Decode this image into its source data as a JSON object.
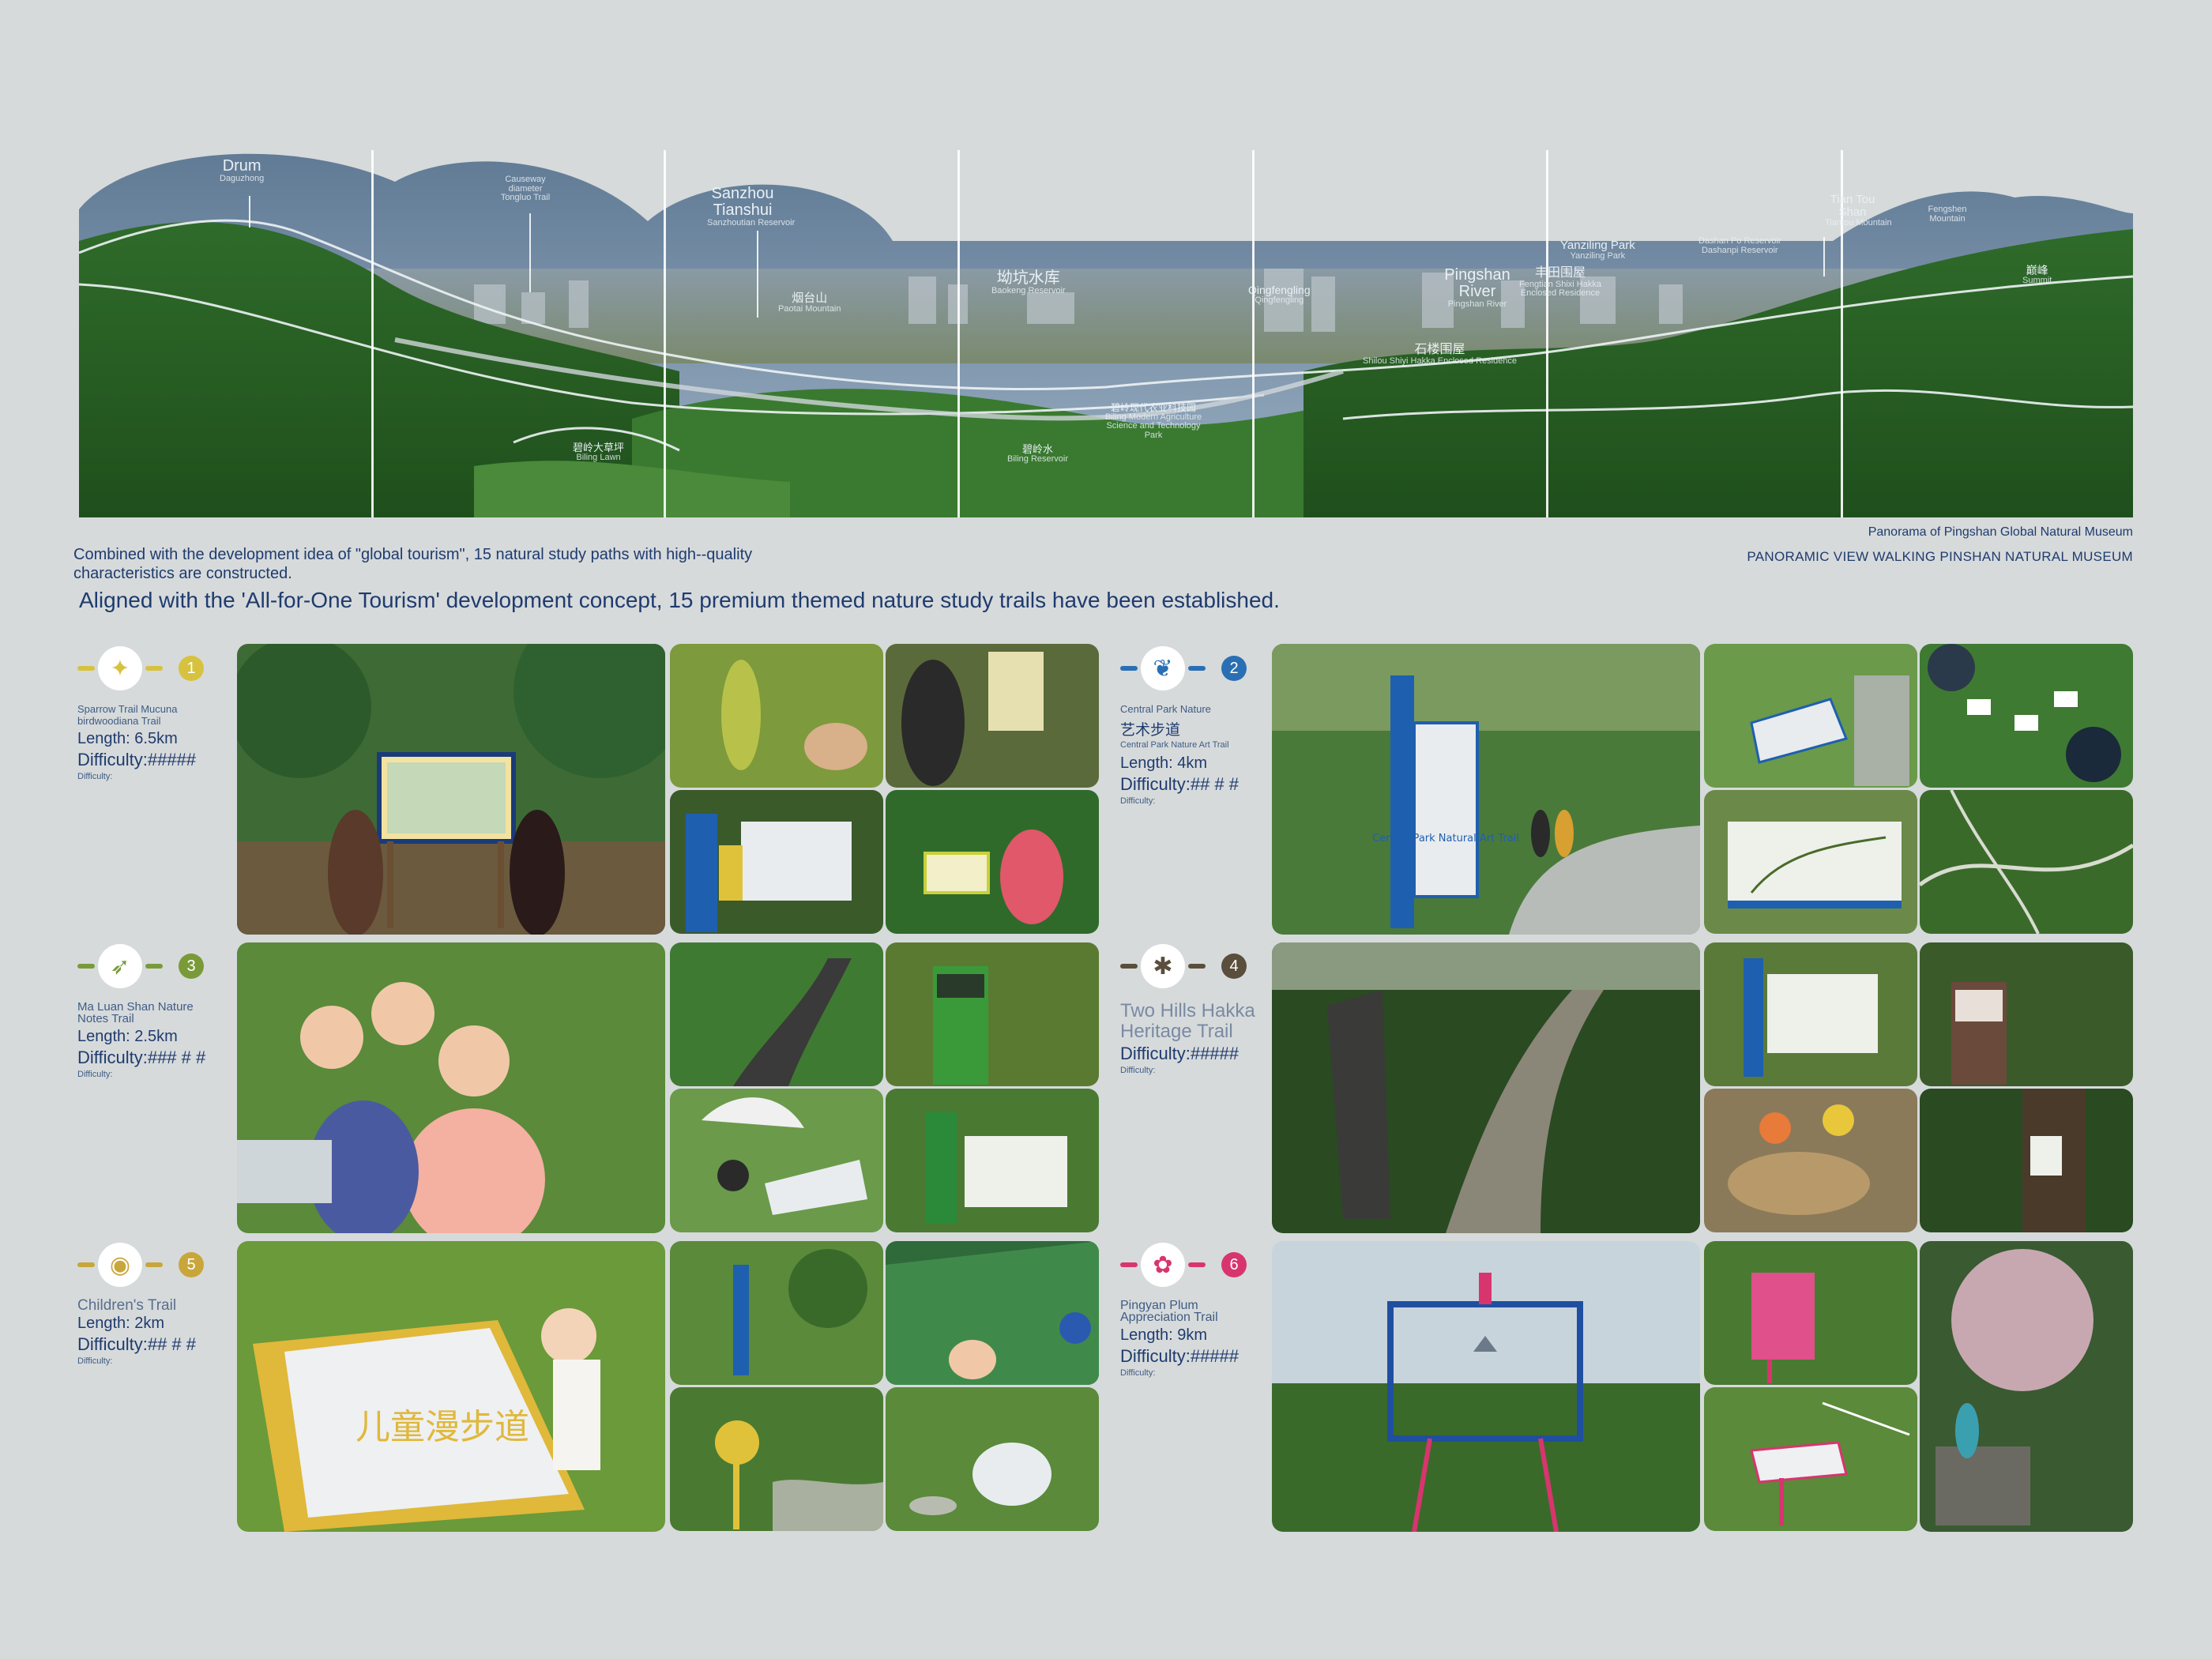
{
  "panorama": {
    "labels": [
      {
        "main": "Drum",
        "sub": "Daguzhong"
      },
      {
        "main": "Causeway diameter",
        "sub": "Tongluo Trail"
      },
      {
        "main": "Sanzhou Tianshui",
        "sub": "Sanzhoutian Reservoir"
      },
      {
        "main": "烟台山",
        "sub": "Paotai Mountain"
      },
      {
        "main": "坳坑水库",
        "sub": "Baokeng Reservoir"
      },
      {
        "main": "Qingfengling",
        "sub": "Qingfengling"
      },
      {
        "main": "Pingshan River",
        "sub": "Pingshan River"
      },
      {
        "main": "丰田围屋",
        "sub": "Fengtian Shixi Hakka Enclosed Residence"
      },
      {
        "main": "石楼围屋",
        "sub": "Shilou Shiyi Hakka Enclosed Residence"
      },
      {
        "main": "Yanziling Park",
        "sub": "Yanziling Park"
      },
      {
        "main": "Dashan Po Reservoir",
        "sub": "Dashanpi Reservoir"
      },
      {
        "main": "Tian Tou Shan",
        "sub": "Tiantou Mountain"
      },
      {
        "main": "Fengshen Mountain",
        "sub": ""
      },
      {
        "main": "巅峰",
        "sub": "Summit"
      },
      {
        "main": "碧岭大草坪",
        "sub": "Biling Lawn"
      },
      {
        "main": "碧岭水",
        "sub": "Biling Reservoir"
      },
      {
        "main": "碧岭现代农业科技园",
        "sub": "Biling Modern Agriculture Science and Technology Park"
      }
    ]
  },
  "captions": {
    "left": "Combined with the development idea of \"global tourism\", 15 natural study paths with high--quality characteristics are constructed.",
    "right_title": "Panorama of Pingshan Global Natural Museum",
    "right_subtitle": "PANORAMIC VIEW WALKING PINSHAN NATURAL MUSEUM",
    "headline": "Aligned with the 'All-for-One Tourism' development concept, 15 premium themed nature study trails have been established."
  },
  "trails": [
    {
      "num": "1",
      "icon": "sparrow-icon",
      "glyph": "✦",
      "color": "#d7c23f",
      "name": "Sparrow Trail Mucuna birdwoodiana Trail",
      "cn": "",
      "length": "Length: 6.5km",
      "difficulty": "Difficulty:#####",
      "difficulty_label": "Difficulty:"
    },
    {
      "num": "2",
      "icon": "butterfly-icon",
      "glyph": "❦",
      "color": "#2a6fb3",
      "name": "Central Park Nature",
      "cn": "艺术步道",
      "cn_sub": "Central Park Nature Art Trail",
      "length": "Length: 4km",
      "difficulty": "Difficulty:## # #",
      "difficulty_label": "Difficulty:"
    },
    {
      "num": "3",
      "icon": "bird-icon",
      "glyph": "➶",
      "color": "#7a9a3a",
      "name": "Ma Luan Shan Nature Notes Trail",
      "cn": "",
      "length": "Length: 2.5km",
      "difficulty": "Difficulty:### # #",
      "difficulty_label": "Difficulty:"
    },
    {
      "num": "4",
      "icon": "ant-icon",
      "glyph": "✱",
      "color": "#5a4e3c",
      "name": "Two Hills Hakka Heritage Trail",
      "cn": "",
      "length": "",
      "difficulty": "Difficulty:#####",
      "difficulty_label": "Difficulty:"
    },
    {
      "num": "5",
      "icon": "tiger-icon",
      "glyph": "◉",
      "color": "#c9a63a",
      "name": "Children's Trail",
      "cn": "",
      "length": "Length: 2km",
      "difficulty": "Difficulty:## # #",
      "difficulty_label": "Difficulty:"
    },
    {
      "num": "6",
      "icon": "plum-blossom-icon",
      "glyph": "✿",
      "color": "#d8356e",
      "name": "Pingyan Plum Appreciation Trail",
      "cn": "",
      "length": "Length: 9km",
      "difficulty": "Difficulty:#####",
      "difficulty_label": "Difficulty:"
    }
  ],
  "signs": {
    "central_park": "Central Park Natural Art Trail",
    "childrens_trail_cn": "儿童漫步道"
  },
  "colors": {
    "background": "#d6dadb",
    "text": "#1f3b6e",
    "forest": "#2f6b2a",
    "sky": "#7f96ad"
  }
}
